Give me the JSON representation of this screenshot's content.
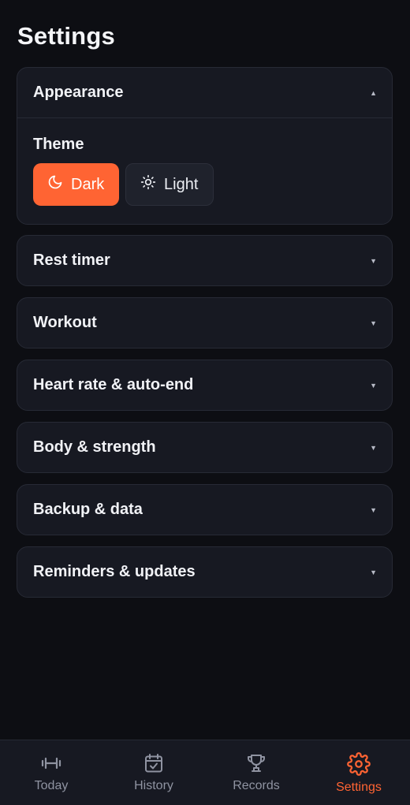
{
  "page": {
    "title": "Settings"
  },
  "sections": {
    "appearance": {
      "title": "Appearance",
      "expanded": true,
      "theme_label": "Theme",
      "options": [
        {
          "label": "Dark",
          "icon": "moon-icon",
          "selected": true
        },
        {
          "label": "Light",
          "icon": "sun-icon",
          "selected": false
        }
      ]
    },
    "rest_timer": {
      "title": "Rest timer",
      "expanded": false
    },
    "workout": {
      "title": "Workout",
      "expanded": false
    },
    "heart_rate": {
      "title": "Heart rate & auto-end",
      "expanded": false
    },
    "body_strength": {
      "title": "Body & strength",
      "expanded": false
    },
    "backup": {
      "title": "Backup & data",
      "expanded": false
    },
    "reminders": {
      "title": "Reminders & updates",
      "expanded": false
    }
  },
  "nav": {
    "items": [
      {
        "label": "Today",
        "icon": "dumbbell-icon",
        "active": false
      },
      {
        "label": "History",
        "icon": "calendar-check-icon",
        "active": false
      },
      {
        "label": "Records",
        "icon": "trophy-icon",
        "active": false
      },
      {
        "label": "Settings",
        "icon": "gear-icon",
        "active": true
      }
    ]
  },
  "colors": {
    "background": "#0d0e13",
    "card": "#171922",
    "accent": "#ff6433",
    "muted": "#8f93a1"
  }
}
